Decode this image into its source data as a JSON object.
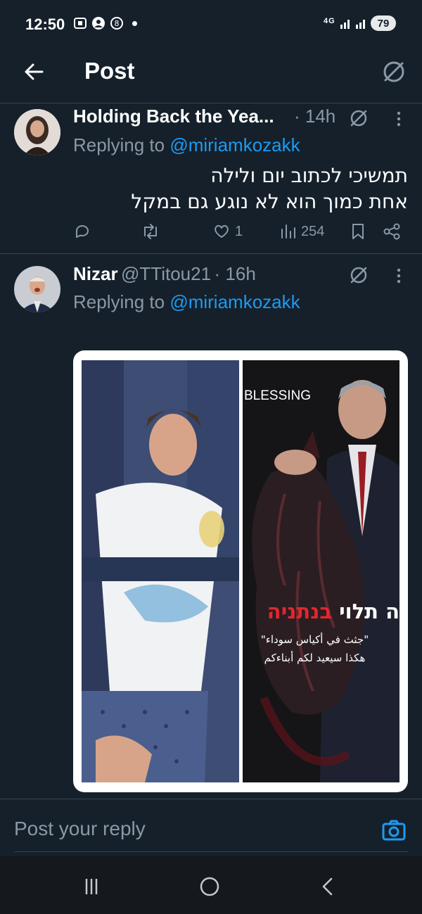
{
  "status_bar": {
    "time": "12:50",
    "network": "4G",
    "battery": "79",
    "icons": [
      "screenshot-icon",
      "account-icon",
      "notification-icon"
    ]
  },
  "header": {
    "title": "Post",
    "back_icon": "back-arrow-icon",
    "grok_icon": "grok-icon"
  },
  "tweets": [
    {
      "name": "Holding Back the Yea...",
      "meta": "· 14h",
      "replying_prefix": "Replying to ",
      "replying_handle": "@miriamkozakk",
      "text_lines": [
        "תמשיכי לכתוב יום ולילה",
        "אחת כמוך הוא לא נוגע גם במקל"
      ],
      "actions": {
        "replies": "",
        "reposts": "",
        "likes": "1",
        "views": "254"
      }
    },
    {
      "name": "Nizar",
      "handle": "@TTitou21",
      "meta": "· 16h",
      "replying_prefix": "Replying to ",
      "replying_handle": "@miriamkozakk",
      "media": {
        "right_caption_en": "BLESSING",
        "right_caption_he_white": "ה תלוי ",
        "right_caption_he_red": "בנתניה",
        "right_caption_ar_1": "\"جثث في أكياس سوداء\"",
        "right_caption_ar_2": "هكذا سيعيد لكم أبناءكم"
      }
    }
  ],
  "reply_box": {
    "placeholder": "Post your reply",
    "camera_icon": "camera-icon"
  },
  "colors": {
    "background": "#15202b",
    "accent": "#1d9bf0",
    "secondary_text": "#8b98a5",
    "divider": "#38444d"
  }
}
